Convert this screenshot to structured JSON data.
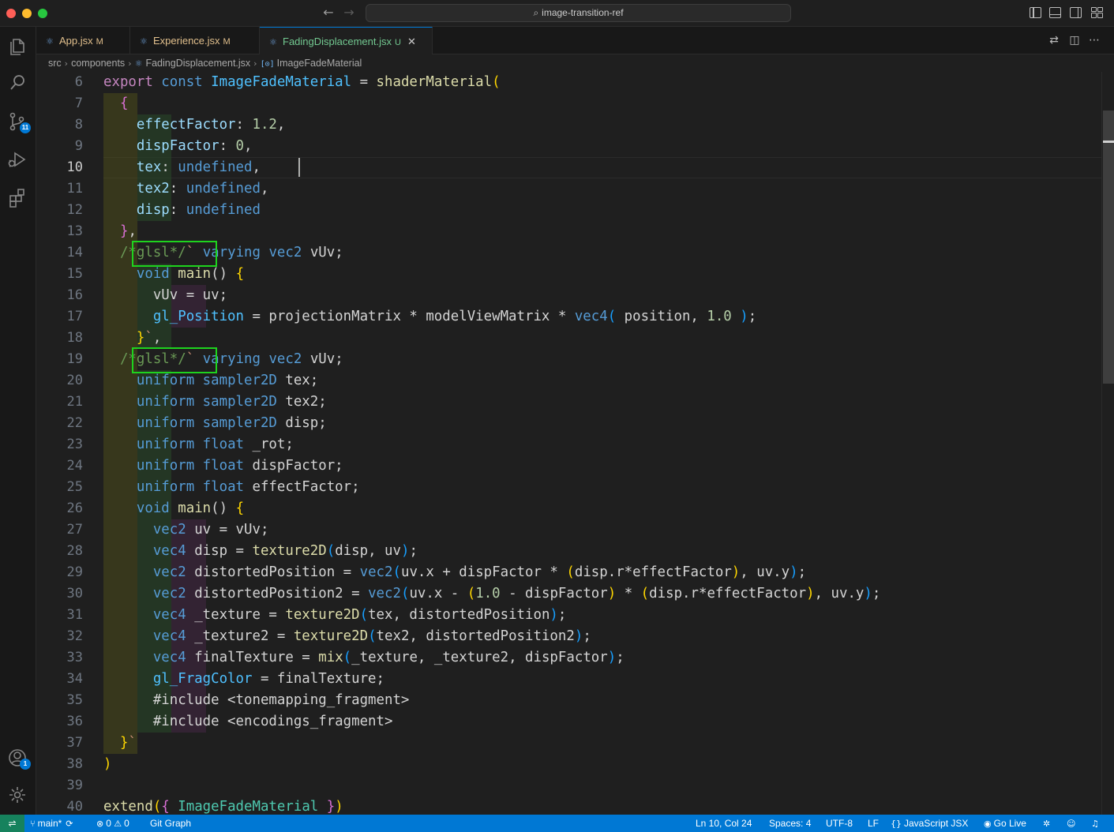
{
  "titlebar": {
    "search_text": "image-transition-ref"
  },
  "activity_bar": {
    "items": [
      "explorer-icon",
      "search-icon",
      "source-control-icon",
      "run-debug-icon",
      "extensions-icon"
    ],
    "source_control_badge": "11",
    "accounts_badge": "1"
  },
  "tabs": [
    {
      "label": "App.jsx",
      "status": "M",
      "active": false
    },
    {
      "label": "Experience.jsx",
      "status": "M",
      "active": false
    },
    {
      "label": "FadingDisplacement.jsx",
      "status": "U",
      "active": true
    }
  ],
  "breadcrumb": {
    "items": [
      "src",
      "components",
      "FadingDisplacement.jsx",
      "ImageFadeMaterial"
    ]
  },
  "editor": {
    "line_numbers": [
      "6",
      "7",
      "8",
      "9",
      "10",
      "11",
      "12",
      "13",
      "14",
      "15",
      "16",
      "17",
      "18",
      "19",
      "20",
      "21",
      "22",
      "23",
      "24",
      "25",
      "26",
      "27",
      "28",
      "29",
      "30",
      "31",
      "32",
      "33",
      "34",
      "35",
      "36",
      "37",
      "38",
      "39",
      "40"
    ],
    "current_line": "10",
    "lines": [
      [
        [
          "export ",
          "cf"
        ],
        [
          "const ",
          "k"
        ],
        [
          "ImageFadeMaterial",
          "v"
        ],
        [
          " = ",
          ""
        ],
        [
          "shaderMaterial",
          "fn"
        ],
        [
          "(",
          "p1"
        ]
      ],
      [
        [
          "  ",
          ""
        ],
        [
          "{",
          "p2"
        ]
      ],
      [
        [
          "    ",
          ""
        ],
        [
          "effectFactor",
          "prop"
        ],
        [
          ": ",
          ""
        ],
        [
          "1.2",
          "num"
        ],
        [
          ",",
          ""
        ]
      ],
      [
        [
          "    ",
          ""
        ],
        [
          "dispFactor",
          "prop"
        ],
        [
          ": ",
          ""
        ],
        [
          "0",
          "num"
        ],
        [
          ",",
          ""
        ]
      ],
      [
        [
          "    ",
          ""
        ],
        [
          "tex",
          "prop"
        ],
        [
          ": ",
          ""
        ],
        [
          "undefined",
          "k"
        ],
        [
          ",",
          ""
        ]
      ],
      [
        [
          "    ",
          ""
        ],
        [
          "tex2",
          "prop"
        ],
        [
          ": ",
          ""
        ],
        [
          "undefined",
          "k"
        ],
        [
          ",",
          ""
        ]
      ],
      [
        [
          "    ",
          ""
        ],
        [
          "disp",
          "prop"
        ],
        [
          ": ",
          ""
        ],
        [
          "undefined",
          "k"
        ]
      ],
      [
        [
          "  ",
          ""
        ],
        [
          "}",
          "p2"
        ],
        [
          ",",
          ""
        ]
      ],
      [
        [
          "  ",
          ""
        ],
        [
          "/*glsl*/",
          "cm"
        ],
        [
          "`",
          "str"
        ],
        [
          " ",
          ""
        ],
        [
          "varying ",
          "k"
        ],
        [
          "vec2 ",
          "k"
        ],
        [
          "vUv;",
          ""
        ]
      ],
      [
        [
          "    ",
          ""
        ],
        [
          "void ",
          "k"
        ],
        [
          "main",
          "fn"
        ],
        [
          "()",
          ""
        ],
        [
          " {",
          "p1"
        ]
      ],
      [
        [
          "      ",
          ""
        ],
        [
          "vUv = uv;",
          ""
        ]
      ],
      [
        [
          "      ",
          ""
        ],
        [
          "gl_Position",
          "v"
        ],
        [
          " = projectionMatrix * modelViewMatrix * ",
          ""
        ],
        [
          "vec4",
          "k"
        ],
        [
          "(",
          "p3"
        ],
        [
          " position, ",
          ""
        ],
        [
          "1.0",
          "num"
        ],
        [
          " )",
          "p3"
        ],
        [
          ";",
          ""
        ]
      ],
      [
        [
          "    ",
          ""
        ],
        [
          "}",
          "p1"
        ],
        [
          "`",
          "str"
        ],
        [
          ",",
          ""
        ]
      ],
      [
        [
          "  ",
          ""
        ],
        [
          "/*glsl*/",
          "cm"
        ],
        [
          "`",
          "str"
        ],
        [
          " ",
          ""
        ],
        [
          "varying ",
          "k"
        ],
        [
          "vec2 ",
          "k"
        ],
        [
          "vUv;",
          ""
        ]
      ],
      [
        [
          "    ",
          ""
        ],
        [
          "uniform ",
          "k"
        ],
        [
          "sampler2D ",
          "k"
        ],
        [
          "tex;",
          ""
        ]
      ],
      [
        [
          "    ",
          ""
        ],
        [
          "uniform ",
          "k"
        ],
        [
          "sampler2D ",
          "k"
        ],
        [
          "tex2;",
          ""
        ]
      ],
      [
        [
          "    ",
          ""
        ],
        [
          "uniform ",
          "k"
        ],
        [
          "sampler2D ",
          "k"
        ],
        [
          "disp;",
          ""
        ]
      ],
      [
        [
          "    ",
          ""
        ],
        [
          "uniform ",
          "k"
        ],
        [
          "float ",
          "k"
        ],
        [
          "_rot;",
          ""
        ]
      ],
      [
        [
          "    ",
          ""
        ],
        [
          "uniform ",
          "k"
        ],
        [
          "float ",
          "k"
        ],
        [
          "dispFactor;",
          ""
        ]
      ],
      [
        [
          "    ",
          ""
        ],
        [
          "uniform ",
          "k"
        ],
        [
          "float ",
          "k"
        ],
        [
          "effectFactor;",
          ""
        ]
      ],
      [
        [
          "    ",
          ""
        ],
        [
          "void ",
          "k"
        ],
        [
          "main",
          "fn"
        ],
        [
          "()",
          ""
        ],
        [
          " {",
          "p1"
        ]
      ],
      [
        [
          "      ",
          ""
        ],
        [
          "vec2 ",
          "k"
        ],
        [
          "uv = vUv;",
          ""
        ]
      ],
      [
        [
          "      ",
          ""
        ],
        [
          "vec4 ",
          "k"
        ],
        [
          "disp = ",
          ""
        ],
        [
          "texture2D",
          "fn"
        ],
        [
          "(",
          "p3"
        ],
        [
          "disp, uv",
          ""
        ],
        [
          ")",
          "p3"
        ],
        [
          ";",
          ""
        ]
      ],
      [
        [
          "      ",
          ""
        ],
        [
          "vec2 ",
          "k"
        ],
        [
          "distortedPosition = ",
          ""
        ],
        [
          "vec2",
          "k"
        ],
        [
          "(",
          "p3"
        ],
        [
          "uv.x + dispFactor * ",
          ""
        ],
        [
          "(",
          "p1"
        ],
        [
          "disp.r*effectFactor",
          ""
        ],
        [
          ")",
          "p1"
        ],
        [
          ", uv.y",
          ""
        ],
        [
          ")",
          "p3"
        ],
        [
          ";",
          ""
        ]
      ],
      [
        [
          "      ",
          ""
        ],
        [
          "vec2 ",
          "k"
        ],
        [
          "distortedPosition2 = ",
          ""
        ],
        [
          "vec2",
          "k"
        ],
        [
          "(",
          "p3"
        ],
        [
          "uv.x - ",
          ""
        ],
        [
          "(",
          "p1"
        ],
        [
          "1.0",
          "num"
        ],
        [
          " - dispFactor",
          ""
        ],
        [
          ")",
          "p1"
        ],
        [
          " * ",
          ""
        ],
        [
          "(",
          "p1"
        ],
        [
          "disp.r*effectFactor",
          ""
        ],
        [
          ")",
          "p1"
        ],
        [
          ", uv.y",
          ""
        ],
        [
          ")",
          "p3"
        ],
        [
          ";",
          ""
        ]
      ],
      [
        [
          "      ",
          ""
        ],
        [
          "vec4 ",
          "k"
        ],
        [
          "_texture = ",
          ""
        ],
        [
          "texture2D",
          "fn"
        ],
        [
          "(",
          "p3"
        ],
        [
          "tex, distortedPosition",
          ""
        ],
        [
          ")",
          "p3"
        ],
        [
          ";",
          ""
        ]
      ],
      [
        [
          "      ",
          ""
        ],
        [
          "vec4 ",
          "k"
        ],
        [
          "_texture2 = ",
          ""
        ],
        [
          "texture2D",
          "fn"
        ],
        [
          "(",
          "p3"
        ],
        [
          "tex2, distortedPosition2",
          ""
        ],
        [
          ")",
          "p3"
        ],
        [
          ";",
          ""
        ]
      ],
      [
        [
          "      ",
          ""
        ],
        [
          "vec4 ",
          "k"
        ],
        [
          "finalTexture = ",
          ""
        ],
        [
          "mix",
          "fn"
        ],
        [
          "(",
          "p3"
        ],
        [
          "_texture, _texture2, dispFactor",
          ""
        ],
        [
          ")",
          "p3"
        ],
        [
          ";",
          ""
        ]
      ],
      [
        [
          "      ",
          ""
        ],
        [
          "gl_FragColor",
          "v"
        ],
        [
          " = finalTexture;",
          ""
        ]
      ],
      [
        [
          "      ",
          ""
        ],
        [
          "#include <tonemapping_fragment>",
          ""
        ]
      ],
      [
        [
          "      ",
          ""
        ],
        [
          "#include <encodings_fragment>",
          ""
        ]
      ],
      [
        [
          "  ",
          ""
        ],
        [
          "}",
          "p1"
        ],
        [
          "`",
          "str"
        ]
      ],
      [
        [
          ")",
          "p1"
        ]
      ],
      [
        [
          "",
          ""
        ]
      ],
      [
        [
          "extend",
          "fn"
        ],
        [
          "(",
          "p1"
        ],
        [
          "{",
          "p2"
        ],
        [
          " ImageFadeMaterial ",
          "cls"
        ],
        [
          "}",
          "p2"
        ],
        [
          ")",
          "p1"
        ]
      ]
    ]
  },
  "statusbar": {
    "branch": "main*",
    "errors": "0",
    "warnings": "0",
    "git_graph": "Git Graph",
    "cursor_position": "Ln 10, Col 24",
    "spaces": "Spaces: 4",
    "encoding": "UTF-8",
    "eol": "LF",
    "language": "JavaScript JSX",
    "go_live": "Go Live"
  }
}
